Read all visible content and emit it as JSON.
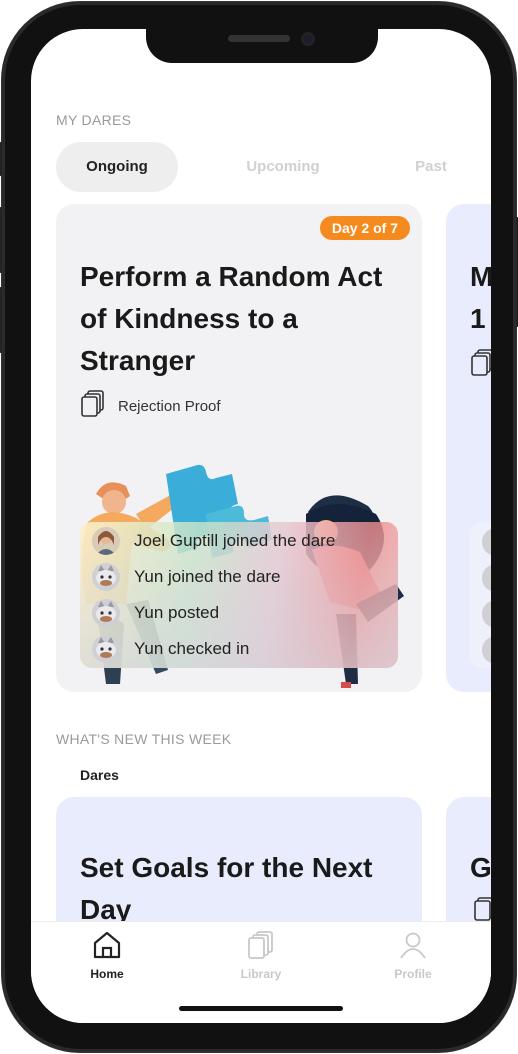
{
  "my_dares": {
    "section_label": "MY DARES",
    "tabs": [
      {
        "label": "Ongoing",
        "active": true
      },
      {
        "label": "Upcoming",
        "active": false
      },
      {
        "label": "Past",
        "active": false
      }
    ]
  },
  "ongoing_card": {
    "badge": "Day 2 of 7",
    "title": "Perform a Random Act of Kindness to a Stranger",
    "category": "Rejection Proof",
    "activity": [
      {
        "text": "Joel Guptill joined the dare",
        "avatar": "person-avatar"
      },
      {
        "text": "Yun joined the dare",
        "avatar": "cat-avatar"
      },
      {
        "text": "Yun posted",
        "avatar": "cat-avatar"
      },
      {
        "text": "Yun checked in",
        "avatar": "cat-avatar"
      }
    ]
  },
  "peek_card": {
    "title_lines": [
      "M",
      "1"
    ]
  },
  "whats_new": {
    "section_label": "WHAT'S NEW THIS WEEK",
    "subsection_label": "Dares",
    "card_title": "Set Goals for the Next Day",
    "peek_letter": "G"
  },
  "tab_bar": {
    "items": [
      {
        "label": "Home",
        "icon": "home-icon",
        "active": true
      },
      {
        "label": "Library",
        "icon": "library-icon",
        "active": false
      },
      {
        "label": "Profile",
        "icon": "profile-icon",
        "active": false
      }
    ]
  },
  "colors": {
    "badge": "#f58a1f",
    "card_bg": "#f2f2f4",
    "accent_card_bg": "#e8ecfd"
  }
}
